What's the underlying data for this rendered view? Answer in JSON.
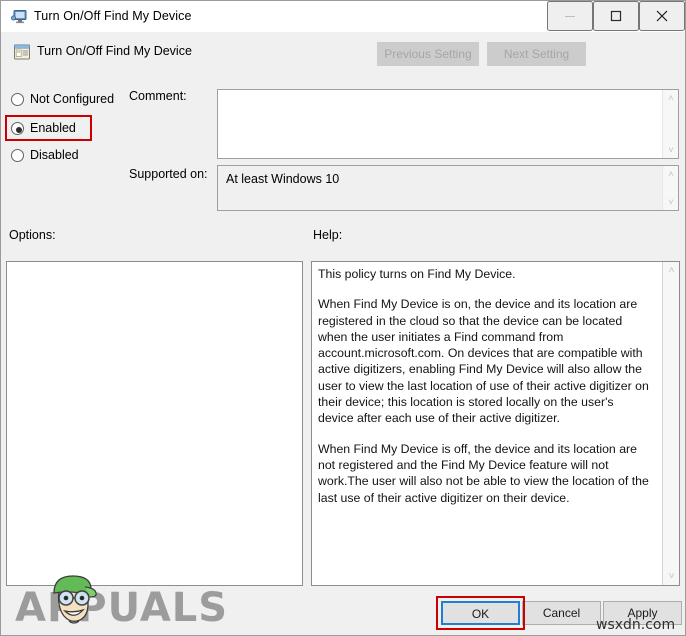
{
  "window": {
    "title": "Turn On/Off Find My Device",
    "title_icon": "monitor-icon",
    "controls": {
      "minimize": "minimize-icon",
      "maximize": "maximize-icon",
      "close": "close-icon"
    }
  },
  "header": {
    "policy_icon": "policy-setting-icon",
    "policy_title": "Turn On/Off Find My Device",
    "previous_setting_label": "Previous Setting",
    "next_setting_label": "Next Setting",
    "previous_setting_enabled": false,
    "next_setting_enabled": false
  },
  "state_options": [
    {
      "id": "not-configured",
      "label": "Not Configured",
      "selected": false
    },
    {
      "id": "enabled",
      "label": "Enabled",
      "selected": true
    },
    {
      "id": "disabled",
      "label": "Disabled",
      "selected": false
    }
  ],
  "fields": {
    "comment_label": "Comment:",
    "comment_value": "",
    "supported_label": "Supported on:",
    "supported_value": "At least Windows 10"
  },
  "panels": {
    "options_label": "Options:",
    "options_content": "",
    "help_label": "Help:",
    "help_paragraphs": [
      "This policy turns on Find My Device.",
      "When Find My Device is on, the device and its location are registered in the cloud so that the device can be located when the user initiates a Find command from account.microsoft.com. On devices that are compatible with active digitizers, enabling Find My Device will also allow the user to view the last location of use of their active digitizer on their device; this location is stored locally on the user's device after each use of their active digitizer.",
      "When Find My Device is off, the device and its location are not registered and the Find My Device feature will not work.The user will also not be able to view the location of the last use of their active digitizer on their device."
    ]
  },
  "buttons": {
    "ok_label": "OK",
    "cancel_label": "Cancel",
    "apply_label": "Apply"
  },
  "scrollbars": {
    "arrow_up": "˄",
    "arrow_down": "˅"
  },
  "annotations": {
    "highlight_color": "#cc0000",
    "focus_color": "#1f7fd0",
    "enabled_highlight_target": "enabled",
    "ok_highlight_target": "ok-button"
  },
  "watermarks": {
    "appuals_text": "APPUALS",
    "wsxdn_text": "wsxdn.com"
  }
}
